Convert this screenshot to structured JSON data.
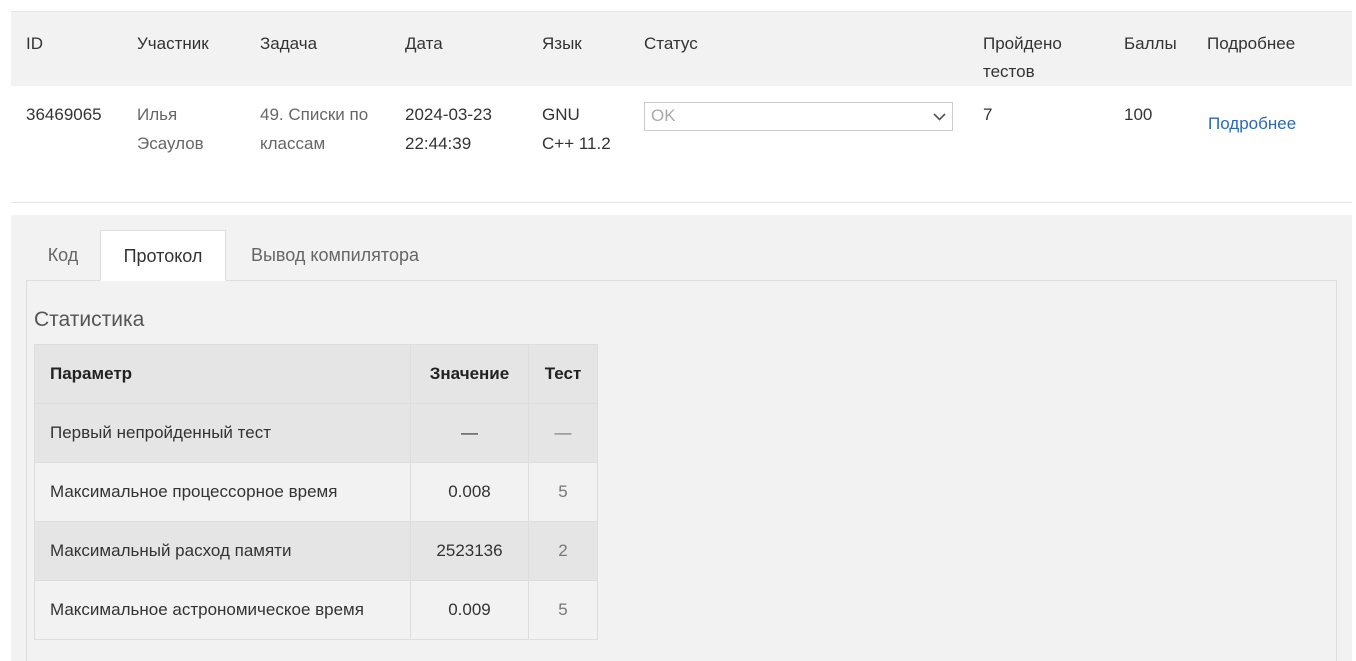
{
  "submissions": {
    "headers": {
      "id": "ID",
      "participant": "Участник",
      "problem": "Задача",
      "date": "Дата",
      "language": "Язык",
      "status": "Статус",
      "tests_passed": "Пройдено тестов",
      "score": "Баллы",
      "details": "Подробнее"
    },
    "row": {
      "id": "36469065",
      "participant": "Илья Эсаулов",
      "problem": "49. Списки по классам",
      "date": "2024-03-23 22:44:39",
      "language": "GNU C++ 11.2",
      "status": "OK",
      "tests_passed": "7",
      "score": "100",
      "details_link": "Подробнее"
    }
  },
  "tabs": [
    {
      "label": "Код",
      "active": false
    },
    {
      "label": "Протокол",
      "active": true
    },
    {
      "label": "Вывод компилятора",
      "active": false
    }
  ],
  "statistics": {
    "title": "Статистика",
    "headers": {
      "param": "Параметр",
      "value": "Значение",
      "test": "Тест"
    },
    "rows": [
      {
        "param": "Первый непройденный тест",
        "value": "—",
        "test": "—"
      },
      {
        "param": "Максимальное процессорное время",
        "value": "0.008",
        "test": "5"
      },
      {
        "param": "Максимальный расход памяти",
        "value": "2523136",
        "test": "2"
      },
      {
        "param": "Максимальное астрономическое время",
        "value": "0.009",
        "test": "5"
      }
    ]
  },
  "colors": {
    "link": "#2a6ab4",
    "header_bg": "#f2f2f2",
    "stripe": "#e5e5e5"
  },
  "icons": {
    "status_dropdown": "chevron-down-icon"
  }
}
